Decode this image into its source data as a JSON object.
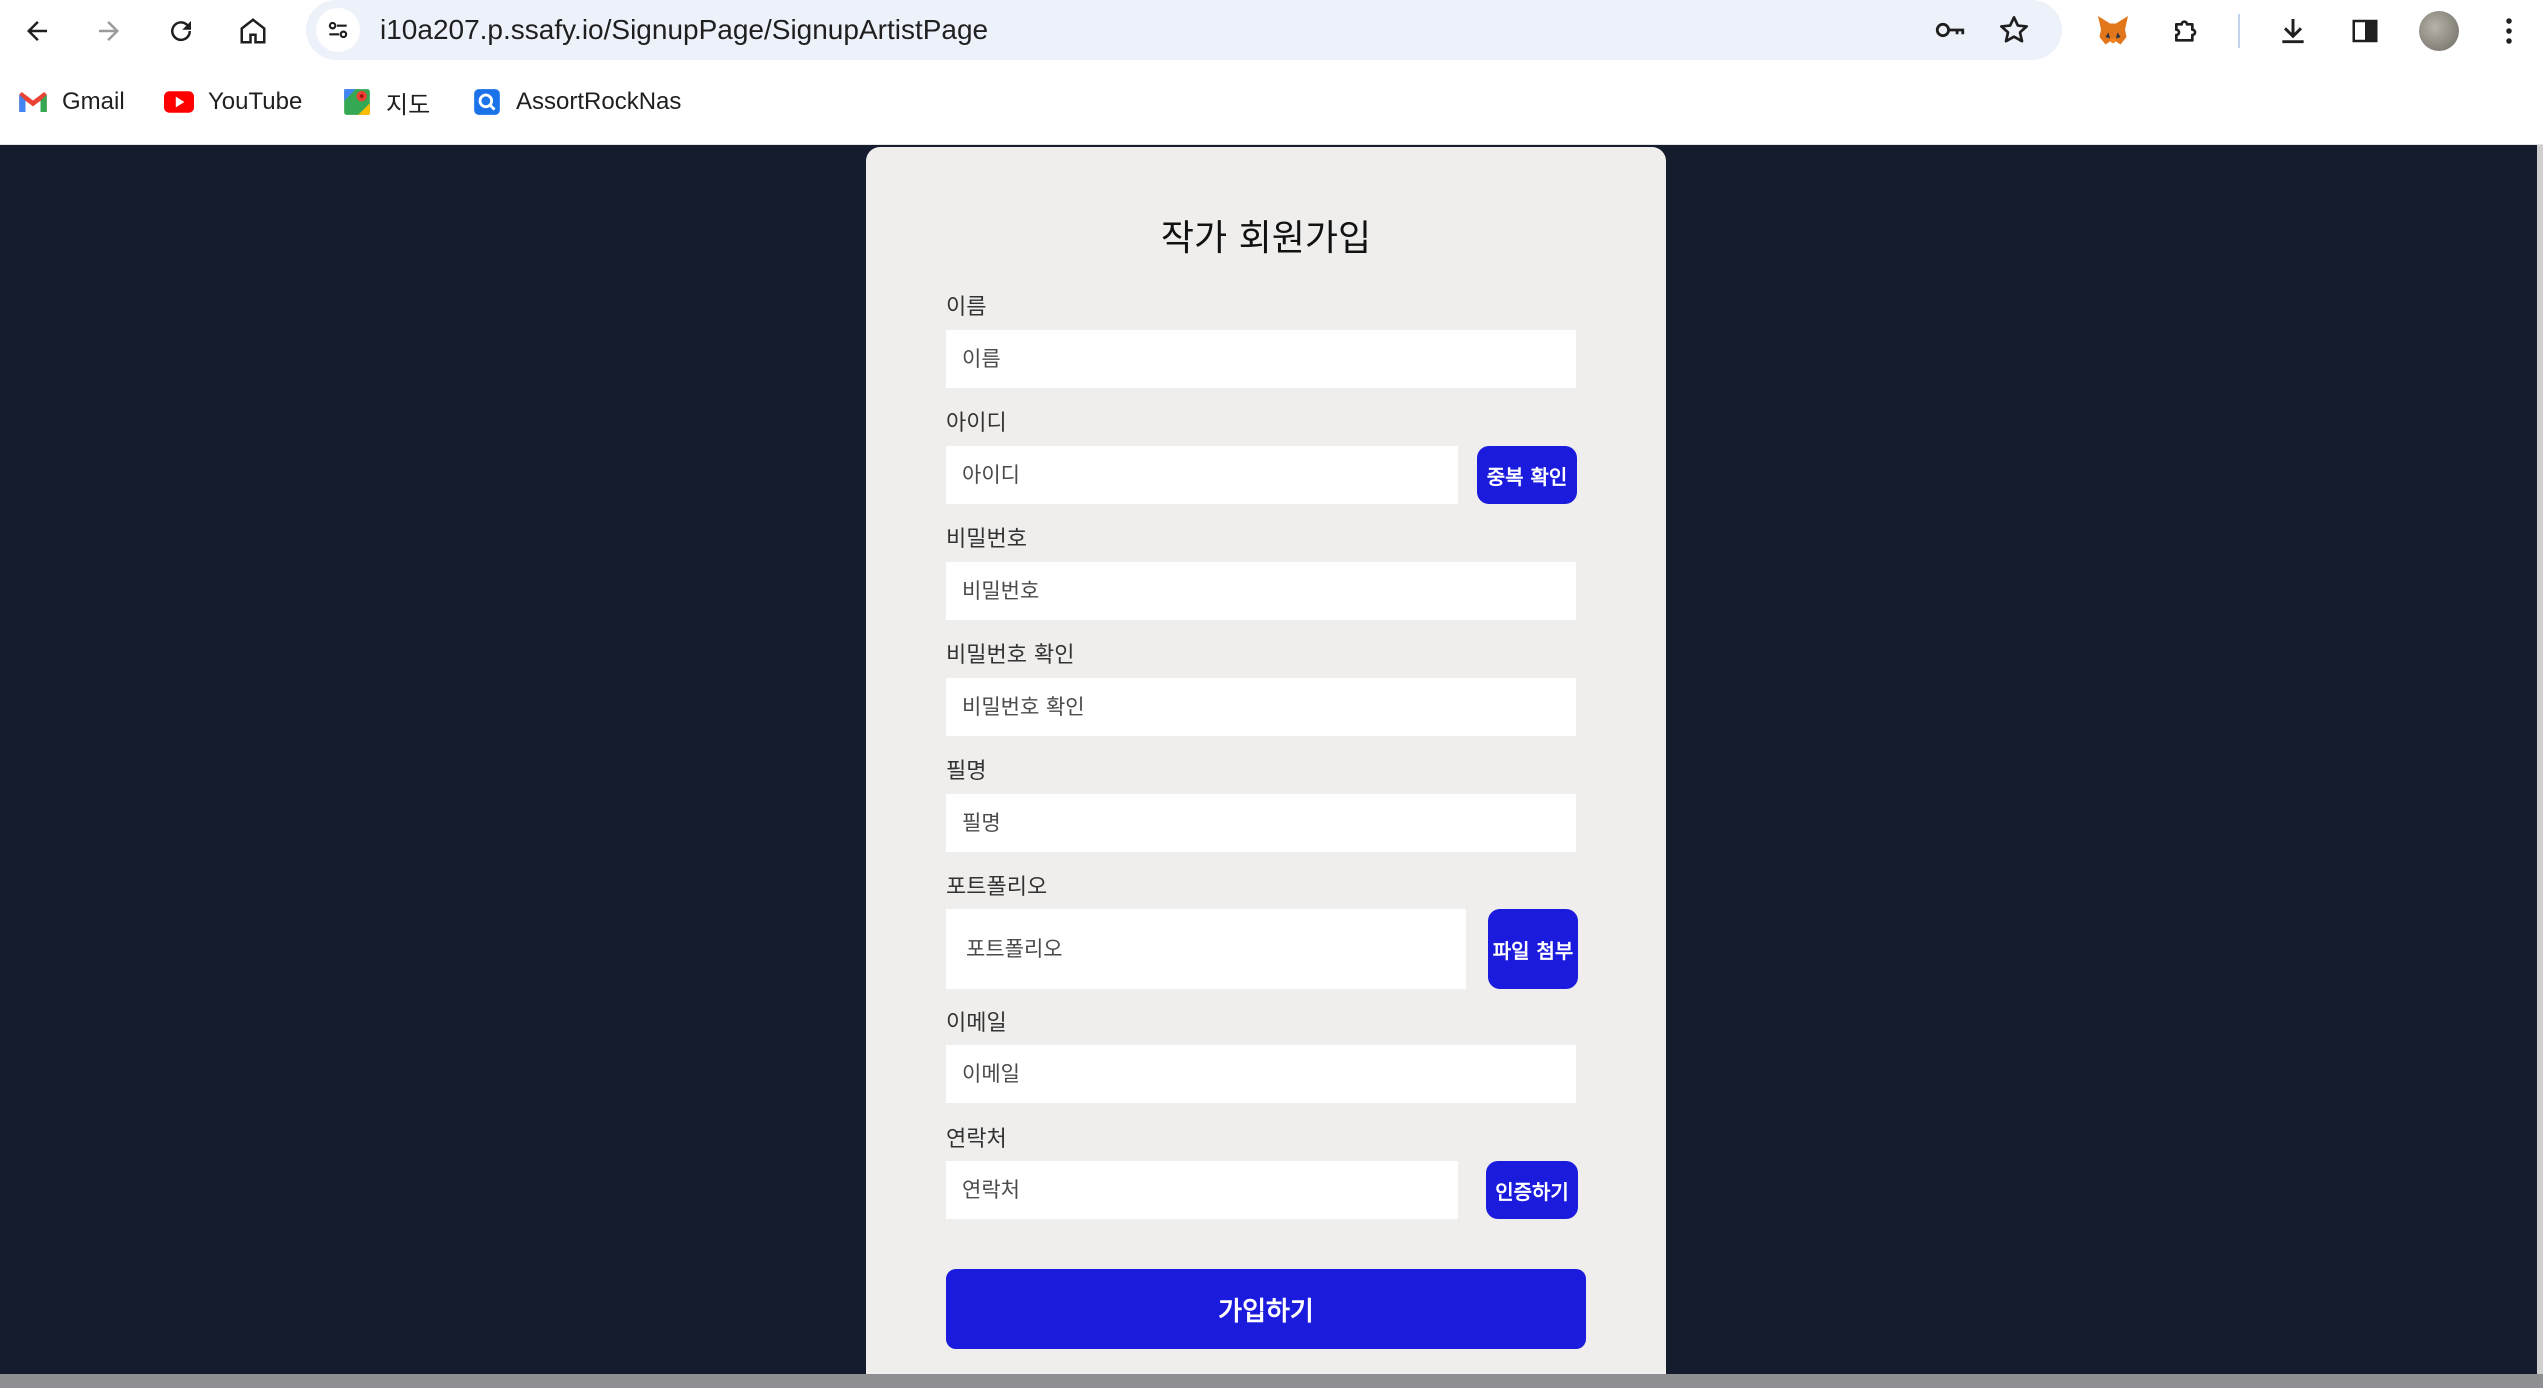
{
  "browser": {
    "url": "i10a207.p.ssafy.io/SignupPage/SignupArtistPage",
    "bookmarks": [
      {
        "label": "Gmail",
        "icon": "gmail-icon"
      },
      {
        "label": "YouTube",
        "icon": "youtube-icon"
      },
      {
        "label": "지도",
        "icon": "maps-icon"
      },
      {
        "label": "AssortRockNas",
        "icon": "nas-icon"
      }
    ]
  },
  "form": {
    "title": "작가 회원가입",
    "name": {
      "label": "이름",
      "placeholder": "이름"
    },
    "userid": {
      "label": "아이디",
      "placeholder": "아이디",
      "button": "중복 확인"
    },
    "password": {
      "label": "비밀번호",
      "placeholder": "비밀번호"
    },
    "password_confirm": {
      "label": "비밀번호 확인",
      "placeholder": "비밀번호 확인"
    },
    "pen_name": {
      "label": "필명",
      "placeholder": "필명"
    },
    "portfolio": {
      "label": "포트폴리오",
      "placeholder": "포트폴리오",
      "button": "파일 첨부"
    },
    "email": {
      "label": "이메일",
      "placeholder": "이메일"
    },
    "phone": {
      "label": "연락처",
      "placeholder": "연락처",
      "button": "인증하기"
    },
    "submit": "가입하기"
  },
  "colors": {
    "page_background": "#141c2e",
    "card_background": "#efeeed",
    "accent_button": "#1a1bdc"
  }
}
